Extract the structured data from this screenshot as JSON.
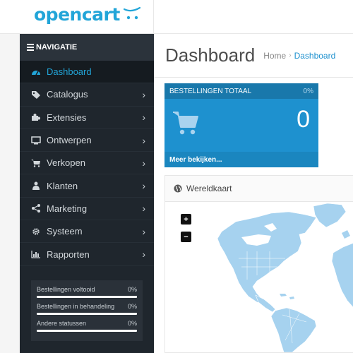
{
  "header": {
    "logo": "opencart"
  },
  "sidebar": {
    "heading": "NAVIGATIE",
    "items": [
      {
        "label": "Dashboard",
        "icon": "dashboard-icon",
        "active": true
      },
      {
        "label": "Catalogus",
        "icon": "tags-icon"
      },
      {
        "label": "Extensies",
        "icon": "puzzle-icon"
      },
      {
        "label": "Ontwerpen",
        "icon": "monitor-icon"
      },
      {
        "label": "Verkopen",
        "icon": "cart-icon"
      },
      {
        "label": "Klanten",
        "icon": "user-icon"
      },
      {
        "label": "Marketing",
        "icon": "share-icon"
      },
      {
        "label": "Systeem",
        "icon": "gear-icon"
      },
      {
        "label": "Rapporten",
        "icon": "bar-chart-icon"
      }
    ],
    "chevron": "›",
    "stats": [
      {
        "label": "Bestellingen voltooid",
        "value": "0%",
        "progress": 0
      },
      {
        "label": "Bestellingen in behandeling",
        "value": "0%",
        "progress": 0
      },
      {
        "label": "Andere statussen",
        "value": "0%",
        "progress": 0
      }
    ]
  },
  "main": {
    "title": "Dashboard",
    "breadcrumb": {
      "home": "Home",
      "separator": "›",
      "current": "Dashboard"
    },
    "orders_tile": {
      "title": "BESTELLINGEN TOTAAL",
      "percent": "0%",
      "value": "0",
      "link": "Meer bekijken..."
    },
    "map": {
      "title": "Wereldkaart",
      "zoom_in": "+",
      "zoom_out": "−",
      "land_color": "#a6d2ef"
    }
  },
  "colors": {
    "accent": "#22a5d8",
    "sidebar_bg": "#1f262d",
    "tile_bg": "#1e91cf"
  }
}
